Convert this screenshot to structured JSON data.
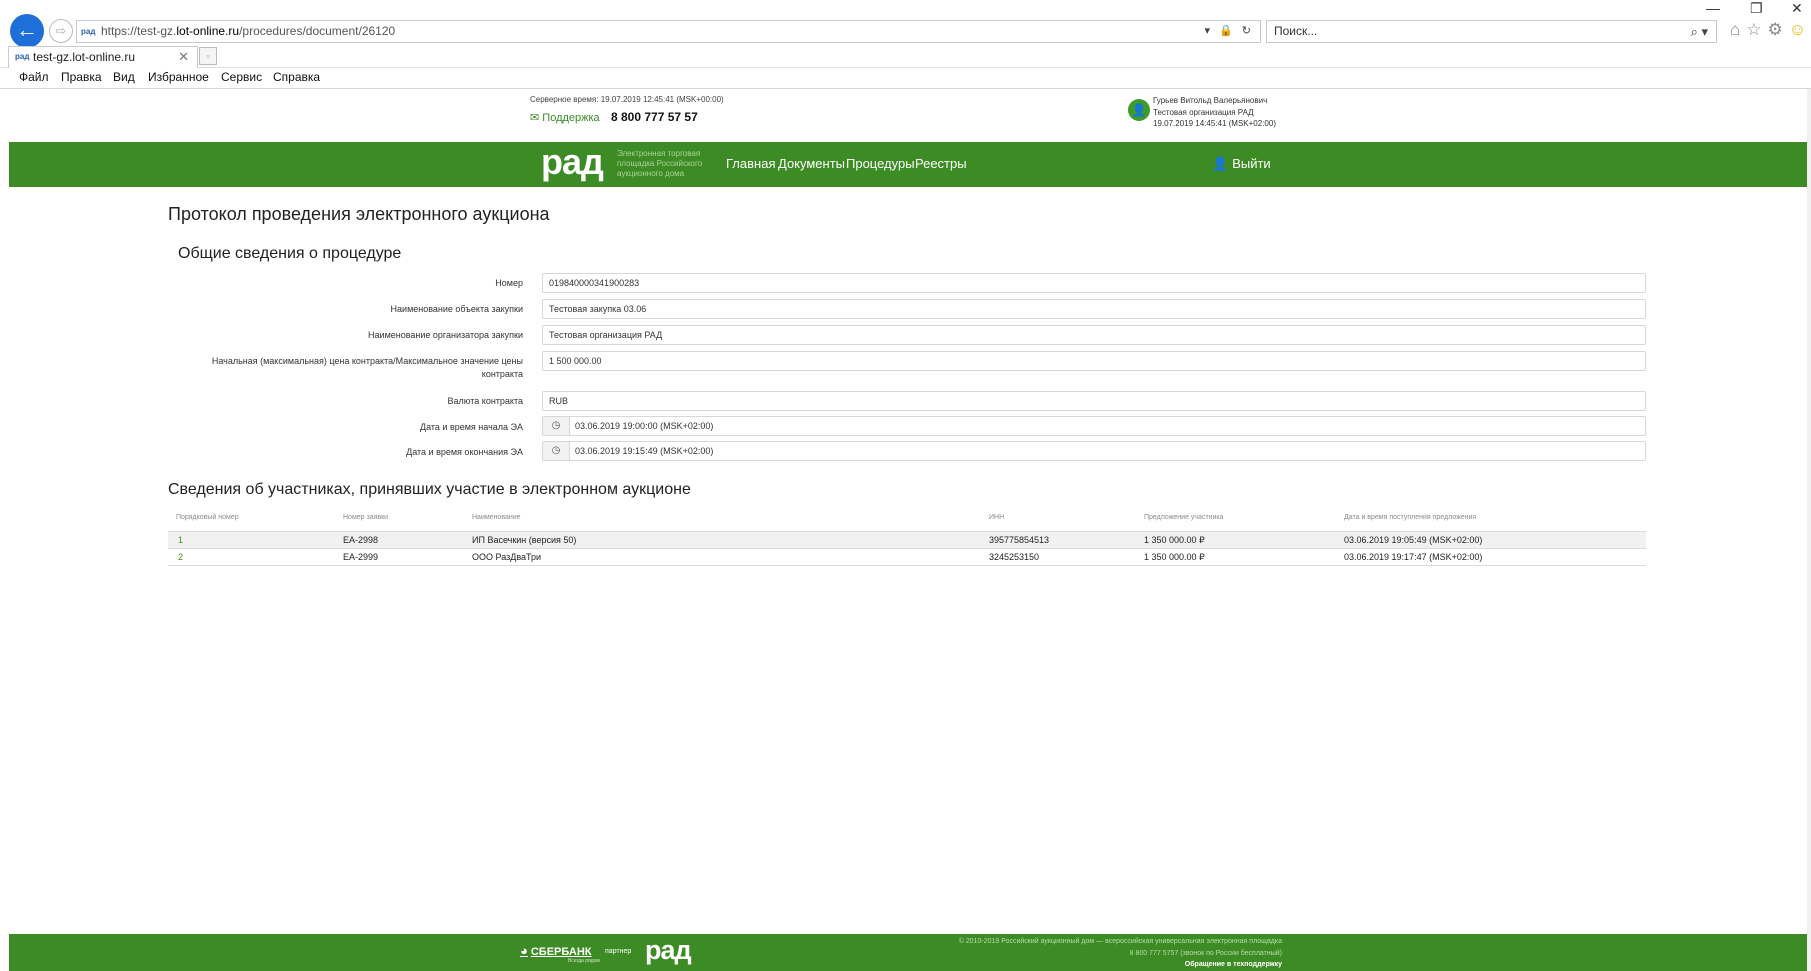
{
  "browser": {
    "url_prefix": "https://test-gz.",
    "url_host": "lot-online.ru",
    "url_path": "/procedures/document/26120",
    "url_tools": "▾ 🔒 ↻",
    "favicon_text": "рад",
    "search_placeholder": "Поиск...",
    "search_icon": "⌕ ▾",
    "tab_title": "test-gz.lot-online.ru",
    "tab_close": "✕",
    "new_tab_icon": "▫",
    "back_icon": "←",
    "forward_icon": "⇨",
    "win_minimize": "—",
    "win_restore": "❐",
    "win_close": "✕",
    "toolbar_icons": {
      "home": "⌂",
      "favorites": "☆",
      "settings": "⚙",
      "feedback": "☺"
    },
    "menu": [
      "Файл",
      "Правка",
      "Вид",
      "Избранное",
      "Сервис",
      "Справка"
    ]
  },
  "header": {
    "server_time": "Серверное время: 19.07.2019 12:45:41 (MSK+00:00)",
    "support_label": "Поддержка",
    "support_icon": "✉",
    "phone": "8 800 777 57 57",
    "user_name": "Гурьев Витольд Валерьянович",
    "user_org": "Тестовая организация РАД",
    "user_time": "19.07.2019 14:45:41 (MSK+02:00)",
    "user_icon": "👤"
  },
  "navbar": {
    "logo": "рад",
    "logo_subtitle": [
      "Электронная торговая",
      "площадка Российского",
      "аукционного дома"
    ],
    "links": [
      "Главная",
      "Документы",
      "Процедуры",
      "Реестры"
    ],
    "logout_label": "Выйти",
    "logout_icon": "👤"
  },
  "main": {
    "title": "Протокол проведения электронного аукциона",
    "general_section_title": "Общие сведения о процедуре",
    "fields": {
      "number": {
        "label": "Номер",
        "value": "019840000341900283"
      },
      "object_name": {
        "label": "Наименование объекта закупки",
        "value": "Тестовая закупка 03.06"
      },
      "organizer": {
        "label": "Наименование организатора закупки",
        "value": "Тестовая организация РАД"
      },
      "price": {
        "label_line1": "Начальная (максимальная) цена контракта/Максимальное значение цены",
        "label_line2": "контракта",
        "value": "1 500 000.00"
      },
      "currency": {
        "label": "Валюта контракта",
        "value": "RUB"
      },
      "start": {
        "label": "Дата и время начала ЭА",
        "value": "03.06.2019 19:00:00 (MSK+02:00)",
        "icon": "◷"
      },
      "end": {
        "label": "Дата и время окончания ЭА",
        "value": "03.06.2019 19:15:49 (MSK+02:00)",
        "icon": "◷"
      }
    },
    "participants_title": "Сведения об участниках, принявших участие в электронном аукционе",
    "table": {
      "headers": [
        "Порядковый номер",
        "Номер заявки",
        "Наименование",
        "ИНН",
        "Предложение участника",
        "Дата и время поступления предложения"
      ],
      "rows": [
        [
          "1",
          "ЕА-2998",
          "ИП Васечкин (версия 50)",
          "395775854513",
          "1 350 000.00 ₽",
          "03.06.2019 19:05:49 (MSK+02:00)"
        ],
        [
          "2",
          "ЕА-2999",
          "ООО РазДваТри",
          "3245253150",
          "1 350 000.00 ₽",
          "03.06.2019 19:17:47 (MSK+02:00)"
        ]
      ]
    }
  },
  "footer": {
    "sber_label": "СБЕРБАНК",
    "sber_sub": "Всегда рядом",
    "partner_label": "партнер",
    "logo": "рад",
    "copyright": "© 2010-2019 Российский аукционный дом — всероссийская универсальная электронная площадка",
    "phone_line": "8 800 777 5757 (звонок по России бесплатный)",
    "help_link": "Обращение в техподдержку"
  }
}
